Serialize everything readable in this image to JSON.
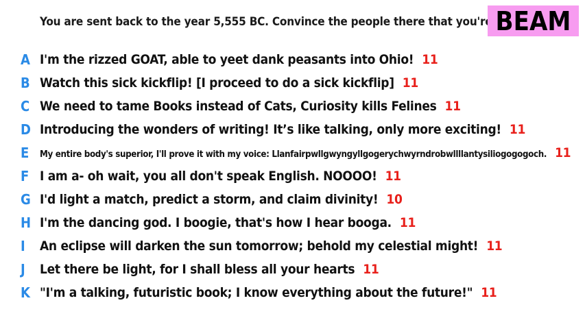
{
  "prompt": "You are sent back to the year 5,555 BC. Convince the people there that you're a god.",
  "badge": "BEAM",
  "colors": {
    "letter": "#2a8ae6",
    "score": "#e8201b",
    "badge_bg": "#f79cf0",
    "text": "#111111"
  },
  "answers": [
    {
      "letter": "A",
      "text": "I'm the rizzed GOAT, able to yeet dank peasants into Ohio!",
      "score": "11"
    },
    {
      "letter": "B",
      "text": "Watch this sick kickflip! [I proceed to do a sick kickflip]",
      "score": "11"
    },
    {
      "letter": "C",
      "text": "We need to tame Books instead of Cats, Curiosity kills Felines",
      "score": "11"
    },
    {
      "letter": "D",
      "text": "Introducing the wonders of writing! It’s like talking, only more exciting!",
      "score": "11"
    },
    {
      "letter": "E",
      "text": "My entire body's superior, I'll prove it with my voice: Llanfairpwllgwyngyllgogerychwyrndrobwllllantysiliogogogoch.",
      "score": "11"
    },
    {
      "letter": "F",
      "text": "I am a- oh wait, you all don't speak English. NOOOO!",
      "score": "11"
    },
    {
      "letter": "G",
      "text": "I'd light a match, predict a storm, and claim divinity!",
      "score": "10"
    },
    {
      "letter": "H",
      "text": "I'm the dancing god. I boogie, that's how I hear booga.",
      "score": "11"
    },
    {
      "letter": "I",
      "text": "An eclipse will darken the sun tomorrow; behold my celestial might!",
      "score": "11"
    },
    {
      "letter": "J",
      "text": "Let there be light, for I shall bless all your hearts",
      "score": "11"
    },
    {
      "letter": "K",
      "text": "\"I'm a talking, futuristic book; I know everything about the future!\"",
      "score": "11"
    }
  ]
}
